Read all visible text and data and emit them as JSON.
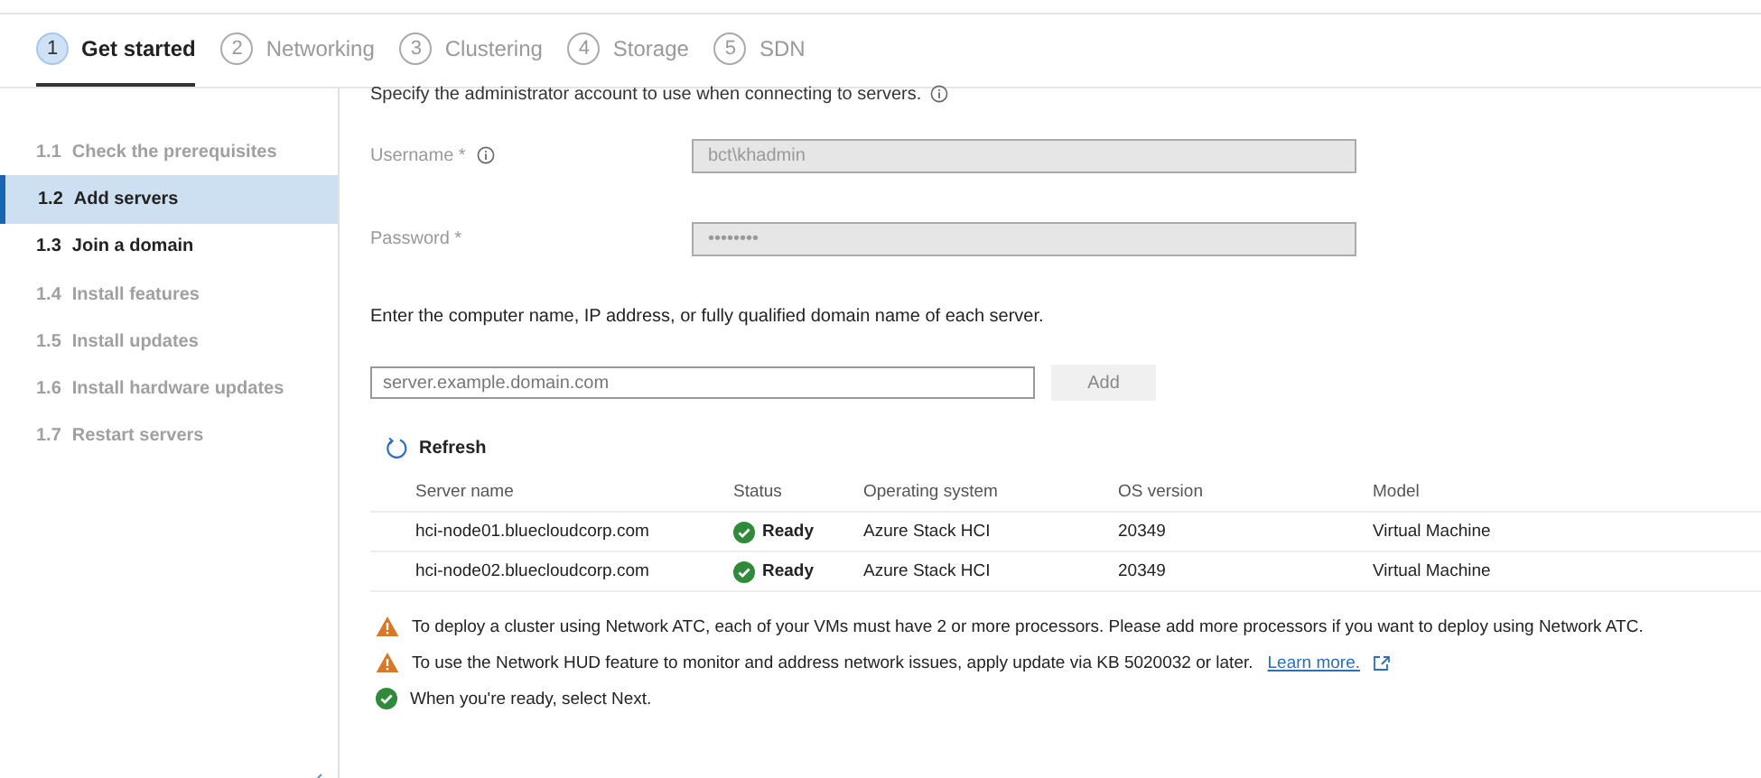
{
  "steps": [
    {
      "number": "1",
      "label": "Get started",
      "selected": true
    },
    {
      "number": "2",
      "label": "Networking",
      "selected": false
    },
    {
      "number": "3",
      "label": "Clustering",
      "selected": false
    },
    {
      "number": "4",
      "label": "Storage",
      "selected": false
    },
    {
      "number": "5",
      "label": "SDN",
      "selected": false
    }
  ],
  "sidebar": {
    "items": [
      {
        "number": "1.1",
        "label": "Check the prerequisites",
        "selected": false,
        "disabled": true
      },
      {
        "number": "1.2",
        "label": "Add servers",
        "selected": true,
        "disabled": false
      },
      {
        "number": "1.3",
        "label": "Join a domain",
        "selected": false,
        "disabled": false
      },
      {
        "number": "1.4",
        "label": "Install features",
        "selected": false,
        "disabled": true
      },
      {
        "number": "1.5",
        "label": "Install updates",
        "selected": false,
        "disabled": true
      },
      {
        "number": "1.6",
        "label": "Install hardware updates",
        "selected": false,
        "disabled": true
      },
      {
        "number": "1.7",
        "label": "Restart servers",
        "selected": false,
        "disabled": true
      }
    ]
  },
  "intro": "Specify the administrator account to use when connecting to servers.",
  "fields": [
    {
      "label": "Username *",
      "info": true,
      "value": "bct\\khadmin"
    },
    {
      "label": "Password *",
      "info": false,
      "value": "••••••••"
    }
  ],
  "instruction": "Enter the computer name, IP address, or fully qualified domain name of each server.",
  "server_input": {
    "placeholder": "server.example.domain.com"
  },
  "add_button": {
    "label": "Add",
    "disabled": true
  },
  "refresh": "Refresh",
  "table": {
    "columns": [
      "Server name",
      "Status",
      "Operating system",
      "OS version",
      "Model"
    ],
    "rows": [
      {
        "server": "hci-node01.bluecloudcorp.com",
        "status": "Ready",
        "os": "Azure Stack HCI",
        "version": "20349",
        "model": "Virtual Machine"
      },
      {
        "server": "hci-node02.bluecloudcorp.com",
        "status": "Ready",
        "os": "Azure Stack HCI",
        "version": "20349",
        "model": "Virtual Machine"
      }
    ]
  },
  "messages": [
    {
      "kind": "warning",
      "text": "To deploy a cluster using Network ATC, each of your VMs must have 2 or more processors. Please add more processors if you want to deploy using Network ATC."
    },
    {
      "kind": "warning",
      "text": "To use the Network HUD feature to monitor and address network issues, apply update via KB 5020032 or later.",
      "link": "Learn more."
    },
    {
      "kind": "success",
      "text": "When you're ready, select Next."
    }
  ]
}
